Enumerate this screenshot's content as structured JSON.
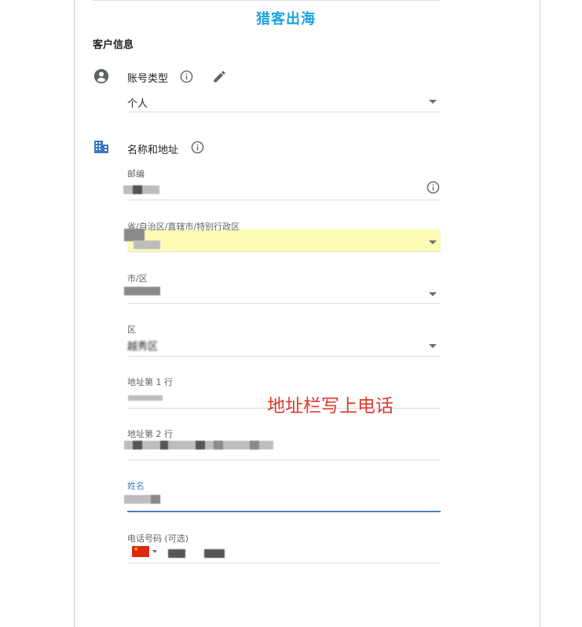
{
  "watermark": "猎客出海",
  "section": {
    "title": "客户信息"
  },
  "account_type": {
    "label": "账号类型",
    "value": "个人"
  },
  "name_address": {
    "label": "名称和地址"
  },
  "fields": {
    "postal": {
      "label": "邮编"
    },
    "province": {
      "label": "省/自治区/直辖市/特别行政区"
    },
    "city": {
      "label": "市/区"
    },
    "district": {
      "label": "区",
      "value": "越秀区"
    },
    "address1": {
      "label": "地址第 1 行"
    },
    "address2": {
      "label": "地址第 2 行"
    },
    "name": {
      "label": "姓名"
    },
    "phone": {
      "label": "电话号码 (可选)"
    }
  },
  "annotation": "地址栏写上电话",
  "colors": {
    "watermark": "#1aa3e0",
    "annotation": "#e03b2e",
    "active_field": "#4a7fc1",
    "highlight": "#fbfbb5"
  },
  "icons": [
    "account-circle-icon",
    "info-icon",
    "edit-pencil-icon",
    "building-icon",
    "dropdown-caret-icon",
    "china-flag-icon"
  ]
}
